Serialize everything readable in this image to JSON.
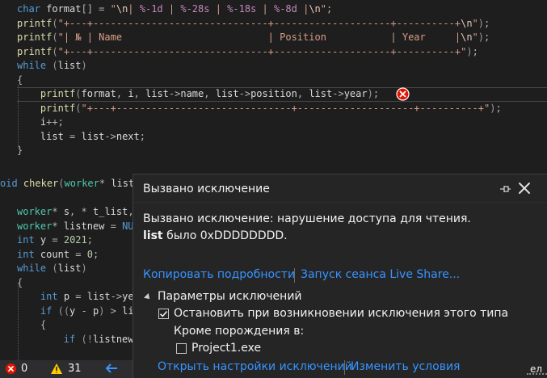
{
  "code": {
    "lines": [
      [
        [
          "kw",
          "char"
        ],
        [
          "id",
          " format"
        ],
        [
          "op",
          "[] = "
        ],
        [
          "str",
          "\""
        ],
        [
          "esc",
          "\\n"
        ],
        [
          "str",
          "| "
        ],
        [
          "fmt",
          "%-1d"
        ],
        [
          "str",
          " | "
        ],
        [
          "fmt",
          "%-28s"
        ],
        [
          "str",
          " | "
        ],
        [
          "fmt",
          "%-18s"
        ],
        [
          "str",
          " | "
        ],
        [
          "fmt",
          "%-8d"
        ],
        [
          "str",
          " |"
        ],
        [
          "esc",
          "\\n"
        ],
        [
          "str",
          "\""
        ],
        [
          "op",
          ";"
        ]
      ],
      [
        [
          "fn",
          "printf"
        ],
        [
          "par",
          "("
        ],
        [
          "str",
          "\"+---+------------------------------+--------------------+----------+"
        ],
        [
          "esc",
          "\\n"
        ],
        [
          "str",
          "\""
        ],
        [
          "par",
          ")"
        ],
        [
          "op",
          ";"
        ]
      ],
      [
        [
          "fn",
          "printf"
        ],
        [
          "par",
          "("
        ],
        [
          "str",
          "\"| № | Name                         | Position           | Year     |"
        ],
        [
          "esc",
          "\\n"
        ],
        [
          "str",
          "\""
        ],
        [
          "par",
          ")"
        ],
        [
          "op",
          ";"
        ]
      ],
      [
        [
          "fn",
          "printf"
        ],
        [
          "par",
          "("
        ],
        [
          "str",
          "\"+---+------------------------------+--------------------+----------+\""
        ],
        [
          "par",
          ")"
        ],
        [
          "op",
          ";"
        ]
      ],
      [
        [
          "kw",
          "while"
        ],
        [
          "op",
          " "
        ],
        [
          "par",
          "("
        ],
        [
          "id",
          "list"
        ],
        [
          "par",
          ")"
        ]
      ],
      [
        [
          "op",
          "{"
        ]
      ],
      [
        [
          "op",
          "    "
        ],
        [
          "fn",
          "printf"
        ],
        [
          "par",
          "("
        ],
        [
          "id",
          "format"
        ],
        [
          "op",
          ", "
        ],
        [
          "id",
          "i"
        ],
        [
          "op",
          ", "
        ],
        [
          "id",
          "list"
        ],
        [
          "op",
          "->"
        ],
        [
          "id",
          "name"
        ],
        [
          "op",
          ", "
        ],
        [
          "id",
          "list"
        ],
        [
          "op",
          "->"
        ],
        [
          "id",
          "position"
        ],
        [
          "op",
          ", "
        ],
        [
          "id",
          "list"
        ],
        [
          "op",
          "->"
        ],
        [
          "id",
          "year"
        ],
        [
          "par",
          ")"
        ],
        [
          "op",
          ";"
        ]
      ],
      [
        [
          "op",
          "    "
        ],
        [
          "fn",
          "printf"
        ],
        [
          "par",
          "("
        ],
        [
          "str",
          "\"+---+------------------------------+--------------------+----------+\""
        ],
        [
          "par",
          ")"
        ],
        [
          "op",
          ";"
        ]
      ],
      [
        [
          "op",
          "    "
        ],
        [
          "id",
          "i"
        ],
        [
          "op",
          "++;"
        ]
      ],
      [
        [
          "op",
          "    "
        ],
        [
          "id",
          "list"
        ],
        [
          "op",
          " = "
        ],
        [
          "id",
          "list"
        ],
        [
          "op",
          "->"
        ],
        [
          "id",
          "next"
        ],
        [
          "op",
          ";"
        ]
      ],
      [
        [
          "op",
          "}"
        ]
      ],
      [
        [
          "op",
          ""
        ]
      ],
      [
        [
          "kw",
          "oid"
        ],
        [
          "op",
          " "
        ],
        [
          "fn",
          "cheker"
        ],
        [
          "par",
          "("
        ],
        [
          "type",
          "worker"
        ],
        [
          "op",
          "* "
        ],
        [
          "id",
          "list"
        ]
      ],
      [
        [
          "op",
          ""
        ]
      ],
      [
        [
          "type",
          "worker"
        ],
        [
          "op",
          "* "
        ],
        [
          "id",
          "s"
        ],
        [
          "op",
          ", * "
        ],
        [
          "id",
          "t_list"
        ],
        [
          "op",
          ","
        ]
      ],
      [
        [
          "type",
          "worker"
        ],
        [
          "op",
          "* "
        ],
        [
          "id",
          "listnew"
        ],
        [
          "op",
          " = "
        ],
        [
          "kw",
          "NU"
        ]
      ],
      [
        [
          "kw",
          "int"
        ],
        [
          "op",
          " "
        ],
        [
          "id",
          "y"
        ],
        [
          "op",
          " = "
        ],
        [
          "num",
          "2021"
        ],
        [
          "op",
          ";"
        ]
      ],
      [
        [
          "kw",
          "int"
        ],
        [
          "op",
          " "
        ],
        [
          "id",
          "count"
        ],
        [
          "op",
          " = "
        ],
        [
          "num",
          "0"
        ],
        [
          "op",
          ";"
        ]
      ],
      [
        [
          "kw",
          "while"
        ],
        [
          "op",
          " "
        ],
        [
          "par",
          "("
        ],
        [
          "id",
          "list"
        ],
        [
          "par",
          ")"
        ]
      ],
      [
        [
          "op",
          "{"
        ]
      ],
      [
        [
          "op",
          "    "
        ],
        [
          "kw",
          "int"
        ],
        [
          "op",
          " "
        ],
        [
          "id",
          "p"
        ],
        [
          "op",
          " = "
        ],
        [
          "id",
          "list"
        ],
        [
          "op",
          "->"
        ],
        [
          "id",
          "ye"
        ]
      ],
      [
        [
          "op",
          "    "
        ],
        [
          "kw",
          "if"
        ],
        [
          "op",
          " "
        ],
        [
          "par",
          "(("
        ],
        [
          "id",
          "y"
        ],
        [
          "op",
          " - "
        ],
        [
          "id",
          "p"
        ],
        [
          "par",
          ")"
        ],
        [
          "op",
          " > "
        ],
        [
          "id",
          "li"
        ]
      ],
      [
        [
          "op",
          "    {"
        ]
      ],
      [
        [
          "op",
          "        "
        ],
        [
          "kw",
          "if"
        ],
        [
          "op",
          " "
        ],
        [
          "par",
          "(!"
        ],
        [
          "id",
          "listnew"
        ]
      ]
    ]
  },
  "popup": {
    "title": "Вызвано исключение",
    "message_line1": "Вызвано исключение: нарушение доступа для чтения.",
    "message_var": "list",
    "message_rest": " было 0xDDDDDDDD.",
    "link_copy": "Копировать подробности",
    "link_live_share": "Запуск сеанса Live Share...",
    "params_header": "Параметры исключений",
    "checkbox_stop_label": "Остановить при возникновении исключения этого типа",
    "checkbox_stop_checked": true,
    "except_label": "Кроме порождения в:",
    "checkbox_project_label": "Project1.exe",
    "checkbox_project_checked": false,
    "link_open_settings": "Открыть настройки исключений",
    "link_change_conditions": "Изменить условия"
  },
  "statusbar": {
    "errors": "0",
    "warnings": "31",
    "right_fragment": "ел"
  },
  "colors": {
    "error_red": "#e51400",
    "warning_yellow": "#ffcc00",
    "link_blue": "#3794ff",
    "back_arrow_blue": "#3794ff"
  }
}
